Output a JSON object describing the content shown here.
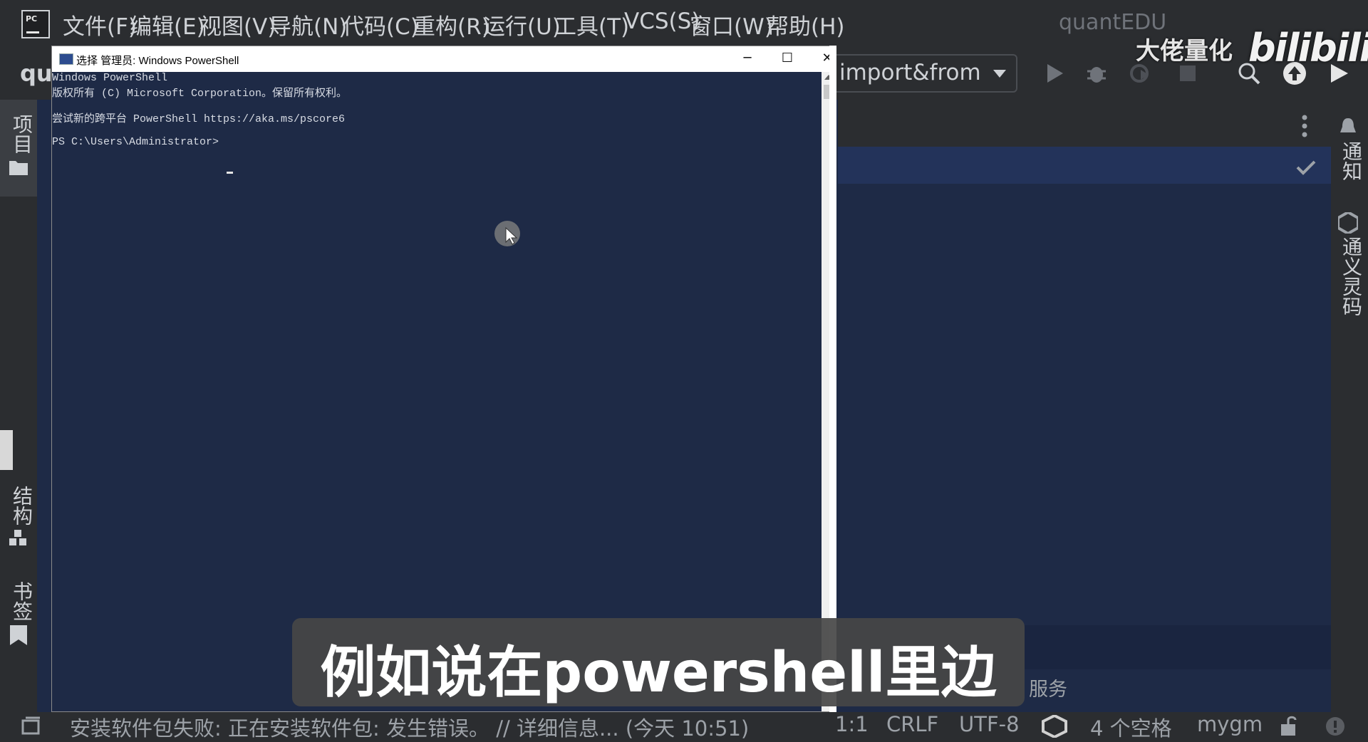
{
  "menubar": {
    "items": [
      "文件(F)",
      "编辑(E)",
      "视图(V)",
      "导航(N)",
      "代码(C)",
      "重构(R)",
      "运行(U)",
      "工具(T)",
      "VCS(S)",
      "窗口(W)",
      "帮助(H)"
    ],
    "project_title": "quantEDU"
  },
  "logo_text": "PC",
  "toolbar": {
    "project_abbrev": "qu",
    "run_config": "import&from"
  },
  "watermark": {
    "text": "大佬量化",
    "brand": "bilibili"
  },
  "left_tools": [
    "项目",
    "结构",
    "书签"
  ],
  "right_tools": [
    "通知",
    "通义灵码"
  ],
  "powershell": {
    "title": "选择 管理员: Windows PowerShell",
    "lines": [
      "Windows PowerShell",
      "版权所有 (C) Microsoft Corporation。保留所有权利。",
      "",
      "尝试新的跨平台 PowerShell https://aka.ms/pscore6",
      "",
      "PS C:\\Users\\Administrator> "
    ],
    "minimize": "─",
    "maximize": "☐",
    "close": "✕"
  },
  "services_label": "服务",
  "subtitle": "例如说在powershell里边",
  "statusbar": {
    "message": "安装软件包失败: 正在安装软件包: 发生错误。 // 详细信息... (今天 10:51)",
    "position": "1:1",
    "line_ending": "CRLF",
    "encoding": "UTF-8",
    "indent": "4 个空格",
    "interpreter": "mygm"
  },
  "colors": {
    "ide_bg": "#2b2d30",
    "editor_bg": "#1e2a46",
    "subtitle_bg": "#464646"
  }
}
